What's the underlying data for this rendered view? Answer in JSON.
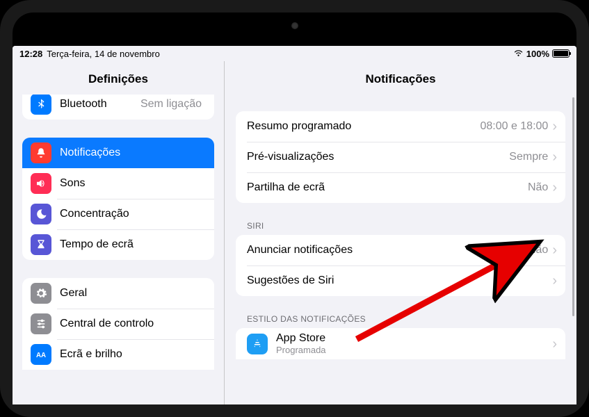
{
  "status": {
    "time": "12:28",
    "date": "Terça-feira, 14 de novembro",
    "battery_pct": "100%"
  },
  "sidebar": {
    "title": "Definições",
    "items": [
      {
        "label": "Bluetooth",
        "value": "Sem ligação",
        "icon": "bluetooth",
        "color": "#007aff"
      },
      {
        "label": "Notificações",
        "icon": "bell",
        "color": "#ff3b30",
        "selected": true
      },
      {
        "label": "Sons",
        "icon": "speaker",
        "color": "#ff2d55"
      },
      {
        "label": "Concentração",
        "icon": "moon",
        "color": "#5856d6"
      },
      {
        "label": "Tempo de ecrã",
        "icon": "hourglass",
        "color": "#5856d6"
      },
      {
        "label": "Geral",
        "icon": "gear",
        "color": "#8e8e93"
      },
      {
        "label": "Central de controlo",
        "icon": "sliders",
        "color": "#8e8e93"
      },
      {
        "label": "Ecrã e brilho",
        "icon": "aa",
        "color": "#007aff"
      }
    ]
  },
  "detail": {
    "title": "Notificações",
    "sections": [
      {
        "header": "",
        "rows": [
          {
            "label": "Resumo programado",
            "value": "08:00 e 18:00"
          },
          {
            "label": "Pré-visualizações",
            "value": "Sempre"
          },
          {
            "label": "Partilha de ecrã",
            "value": "Não"
          }
        ]
      },
      {
        "header": "SIRI",
        "rows": [
          {
            "label": "Anunciar notificações",
            "value": "Não"
          },
          {
            "label": "Sugestões de Siri",
            "value": ""
          }
        ]
      },
      {
        "header": "ESTILO DAS NOTIFICAÇÕES",
        "rows": [
          {
            "label": "App Store",
            "sub": "Programada",
            "icon": "appstore",
            "color": "#1e9ef4"
          }
        ]
      }
    ]
  }
}
